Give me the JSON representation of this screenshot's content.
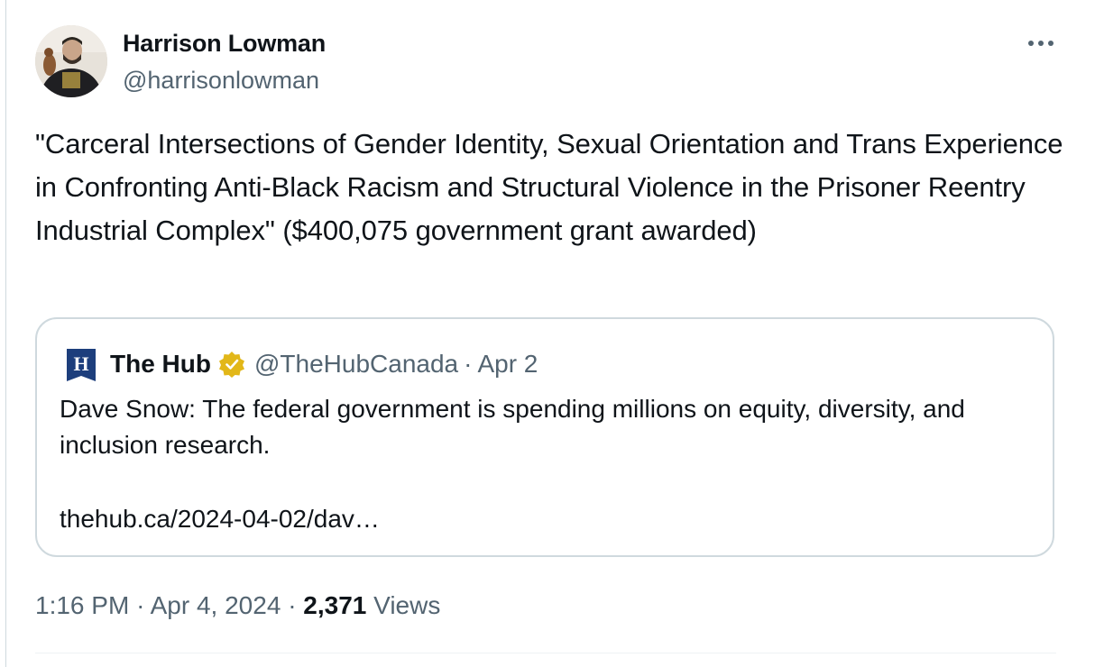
{
  "author": {
    "name": "Harrison Lowman",
    "handle": "@harrisonlowman",
    "avatar_icon": "person-avatar"
  },
  "tweet": {
    "text": "\"Carceral Intersections of Gender Identity, Sexual Orientation and Trans Experience in Confronting Anti-Black Racism and Structural Violence in the Prisoner Reentry Industrial Complex\" ($400,075 government grant awarded)"
  },
  "quote": {
    "logo_letter": "H",
    "name": "The Hub",
    "handle": "@TheHubCanada",
    "separator": "·",
    "date": "Apr 2",
    "text": "Dave Snow: The federal government is spending millions on equity, diversity, and inclusion research.",
    "link": "thehub.ca/2024-04-02/dav…"
  },
  "meta": {
    "time": "1:16 PM",
    "separator1": "·",
    "date": "Apr 4, 2024",
    "separator2": "·",
    "views_count": "2,371",
    "views_label": "Views"
  },
  "colors": {
    "text_primary": "#0f1419",
    "text_secondary": "#536471",
    "border": "#cfd9de",
    "verified_gold": "#e2b719",
    "hub_navy": "#1d3e7c"
  }
}
